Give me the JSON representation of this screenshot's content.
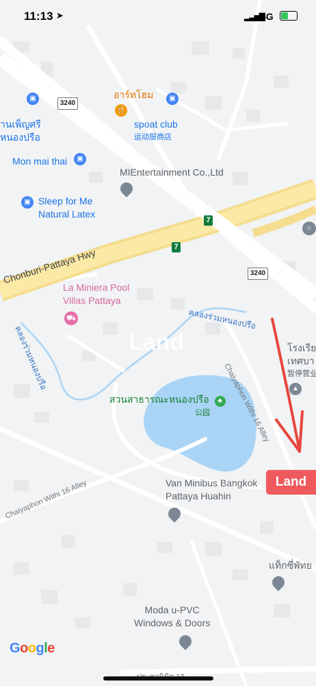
{
  "status_bar": {
    "time": "11:13",
    "network": "4G"
  },
  "map": {
    "roads": {
      "hwy_name": "Chonburi-Pattaya Hwy",
      "route_3240_top": "3240",
      "route_3240_bottom": "3240",
      "alley_1": "Chaiyaphon Withi 16 Alley",
      "alley_2": "Chaiyaphon Withi 16 Alley",
      "bottom_road": "ประชานิมิต 13"
    },
    "pois": {
      "thai_top_left_line1": "านเพ็ญศรี",
      "thai_top_left_line2": "หนองปรือ",
      "art_home": "อาร์ทโฮม",
      "spoat_club_line1": "spoat club",
      "spoat_club_line2": "运动服商店",
      "mon_mai_thai": "Mon mai thai",
      "mientertainment": "MIEntertainment Co.,Ltd",
      "sleep_line1": "Sleep for Me",
      "sleep_line2": "Natural Latex",
      "la_miniera_line1": "La Miniera Pool",
      "la_miniera_line2": "Villas Pattaya",
      "school_line1": "โรงเรีย",
      "school_line2": "เทศบา",
      "school_line3": "暂停营业",
      "park_line1": "สวนสาธารณะหนองปรือ",
      "park_line2": "公园",
      "van_line1": "Van Minibus Bangkok",
      "van_line2": "Pattaya Huahin",
      "thai_right": "แท็กซี่พัทย",
      "moda_line1": "Moda u-PVC",
      "moda_line2": "Windows & Doors"
    },
    "water": {
      "canal_1": "คลองร่วมหนองปรือ",
      "canal_2": "คลองร่วมหนองปรือ"
    },
    "route_7_label": "7",
    "watermark": "Land",
    "land_tag": "Land",
    "google_logo": "Google",
    "annotation_color": "#e8453c"
  }
}
